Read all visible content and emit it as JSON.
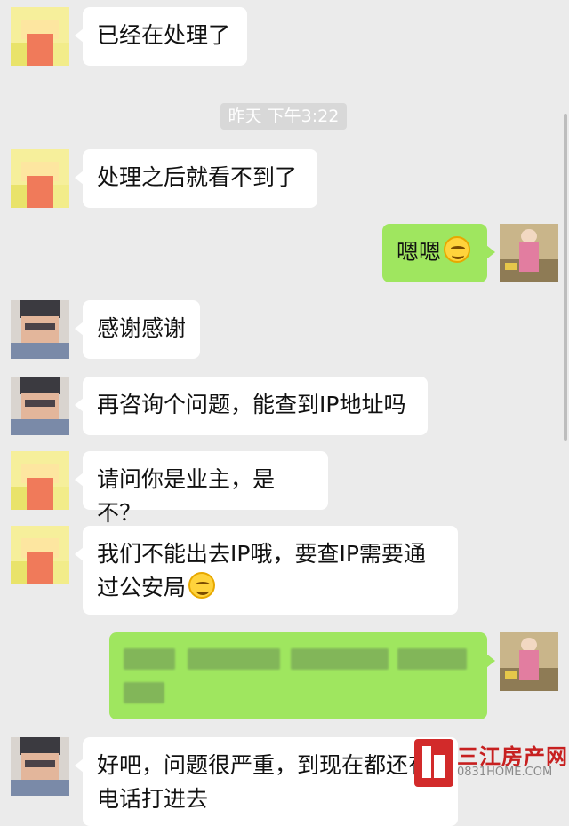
{
  "colors": {
    "background": "#ebebeb",
    "incoming_bubble": "#ffffff",
    "outgoing_bubble": "#9fe65f",
    "timestamp_bg": "#d8d8d8",
    "watermark_red": "#c72020"
  },
  "timestamp": "昨天 下午3:22",
  "messages": {
    "m1": {
      "text": "已经在处理了"
    },
    "m2": {
      "text": "处理之后就看不到了"
    },
    "m3": {
      "text": "嗯嗯",
      "emoji": "smiling-face-icon"
    },
    "m4": {
      "text": "感谢感谢"
    },
    "m5": {
      "text": "再咨询个问题，能查到IP地址吗"
    },
    "m6": {
      "text": "请问你是业主，是不？"
    },
    "m7": {
      "line1": "我们不能出去IP哦，要查IP需要通",
      "line2": "过公安局",
      "emoji": "grinning-face-icon"
    },
    "m8": {
      "text": "",
      "note": "blurred-content"
    },
    "m9": {
      "line1": "好吧，问题很严重，到现在都还有",
      "line2": "电话打进去"
    }
  },
  "watermark": {
    "name": "三江房产网",
    "url": "0831HOME.COM"
  }
}
